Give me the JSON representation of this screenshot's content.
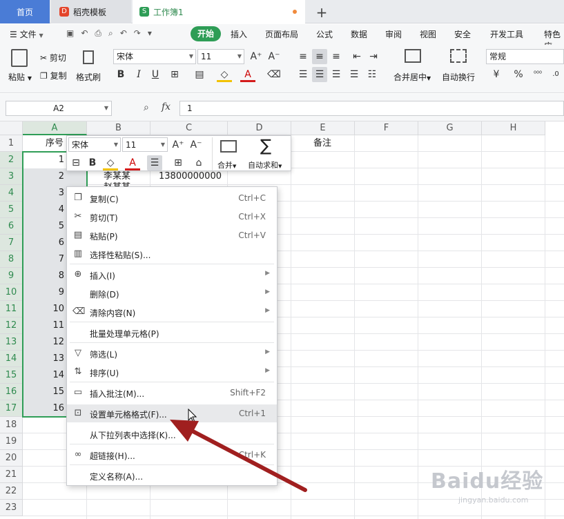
{
  "tabs": {
    "home": "首页",
    "template": "稻壳模板",
    "workbook": "工作簿1"
  },
  "menu": {
    "file": "文件",
    "start": "开始",
    "insert": "插入",
    "layout": "页面布局",
    "formula": "公式",
    "data": "数据",
    "review": "审阅",
    "view": "视图",
    "security": "安全",
    "dev": "开发工具",
    "special": "特色应"
  },
  "ribbon": {
    "paste": "粘贴",
    "cut": "剪切",
    "copy": "复制",
    "format_painter": "格式刷",
    "font_name": "宋体",
    "font_size": "11",
    "merge_center": "合并居中",
    "wrap": "自动换行",
    "number_format": "常规"
  },
  "formula_bar": {
    "name_box": "A2",
    "fx": "fx",
    "value": "1"
  },
  "columns": [
    "A",
    "B",
    "C",
    "D",
    "E",
    "F",
    "G",
    "H"
  ],
  "rows": [
    "1",
    "2",
    "3",
    "4",
    "5",
    "6",
    "7",
    "8",
    "9",
    "10",
    "11",
    "12",
    "13",
    "14",
    "15",
    "16",
    "17",
    "18",
    "19",
    "20",
    "21",
    "22",
    "23"
  ],
  "cells": {
    "a1": "序号",
    "e1": "备注",
    "b3": "李某某",
    "c3": "13800000000",
    "b4": "赵某某",
    "a_values": [
      "1",
      "2",
      "3",
      "4",
      "5",
      "6",
      "7",
      "8",
      "9",
      "10",
      "11",
      "12",
      "13",
      "14",
      "15",
      "16"
    ]
  },
  "mini_toolbar": {
    "font_name": "宋体",
    "font_size": "11",
    "merge": "合并",
    "autosum": "自动求和"
  },
  "context_menu": {
    "copy": "复制(C)",
    "copy_sc": "Ctrl+C",
    "cut": "剪切(T)",
    "cut_sc": "Ctrl+X",
    "paste": "粘贴(P)",
    "paste_sc": "Ctrl+V",
    "paste_special": "选择性粘贴(S)...",
    "insert": "插入(I)",
    "delete": "删除(D)",
    "clear": "清除内容(N)",
    "batch": "批量处理单元格(P)",
    "filter": "筛选(L)",
    "sort": "排序(U)",
    "comment": "插入批注(M)...",
    "comment_sc": "Shift+F2",
    "format_cells": "设置单元格格式(F)...",
    "format_cells_sc": "Ctrl+1",
    "pick_list": "从下拉列表中选择(K)...",
    "hyperlink": "超链接(H)...",
    "hyperlink_sc": "Ctrl+K",
    "define_name": "定义名称(A)..."
  },
  "watermark": {
    "brand": "Baidu经验",
    "url": "jingyan.baidu.com"
  },
  "colors": {
    "accent": "#2e9d56",
    "tab_home": "#4a7cd6",
    "arrow": "#a01f1f"
  }
}
